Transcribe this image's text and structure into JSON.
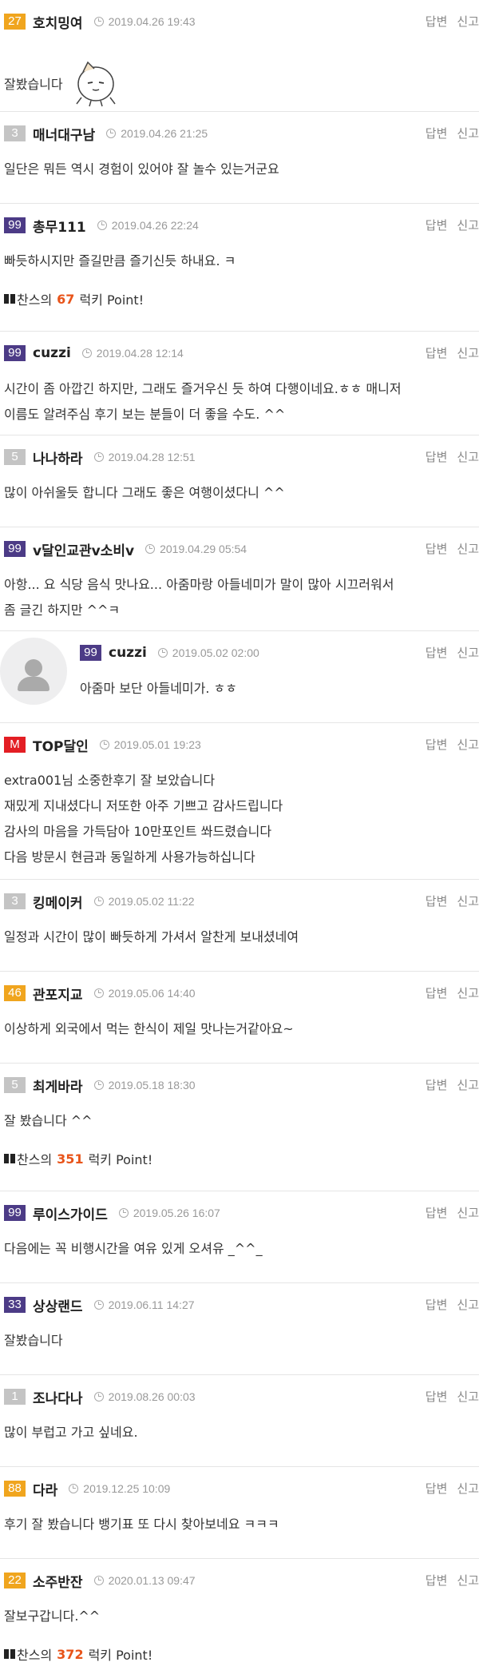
{
  "actions": {
    "reply": "답변",
    "report": "신고"
  },
  "point_prefix": "찬스의",
  "point_suffix": "럭키 Point!",
  "level_colors": {
    "purple": "#4c3b86",
    "gold": "#f0a51e",
    "grey": "#c4c4c4",
    "red": "#e31e24"
  },
  "comments": [
    {
      "level": "27",
      "nick": "호치밍여",
      "date": "2019.04.26 19:43",
      "text": [
        "잘봤습니다"
      ],
      "emoticon": "doodle-face-emoticon"
    },
    {
      "level": "3",
      "nick": "매너대구남",
      "date": "2019.04.26 21:25",
      "text": [
        "일단은 뭐든 역시 경험이 있어야 잘 놀수 있는거군요"
      ]
    },
    {
      "level": "99",
      "nick": "총무111",
      "date": "2019.04.26 22:24",
      "text": [
        "빠듯하시지만 즐길만큼 즐기신듯 하내요. ㅋ"
      ],
      "points": "67"
    },
    {
      "level": "99",
      "nick": "cuzzi",
      "date": "2019.04.28 12:14",
      "text": [
        "시간이 좀 아깝긴 하지만, 그래도 즐거우신 듯 하여 다행이네요.ㅎㅎ 매니저",
        "이름도 알려주심 후기 보는 분들이 더 좋을 수도. ^^"
      ]
    },
    {
      "level": "5",
      "nick": "나나하라",
      "date": "2019.04.28 12:51",
      "text": [
        "많이 아쉬울듯 합니다 그래도 좋은 여행이셨다니 ^^"
      ]
    },
    {
      "level": "99",
      "nick": "v달인교관v소비v",
      "date": "2019.04.29 05:54",
      "text": [
        "아항... 요 식당 음식 맛나요... 아줌마랑 아들네미가 말이 많아 시끄러워서",
        "좀 글긴 하지만 ^^ㅋ"
      ]
    },
    {
      "level": "99",
      "nick": "cuzzi",
      "date": "2019.05.02 02:00",
      "text": [
        "아줌마 보단 아들네미가. ㅎㅎ"
      ],
      "reply": true
    },
    {
      "level": "M",
      "nick": "TOP달인",
      "date": "2019.05.01 19:23",
      "text": [
        "extra001님 소중한후기 잘 보았습니다",
        "재밌게 지내셨다니 저또한 아주 기쁘고 감사드립니다",
        "감사의 마음을 가득담아 10만포인트 쏴드렸습니다",
        "다음 방문시 현금과 동일하게 사용가능하십니다"
      ]
    },
    {
      "level": "3",
      "nick": "킹메이커",
      "date": "2019.05.02 11:22",
      "text": [
        "일정과 시간이 많이 빠듯하게 가셔서 알찬게 보내셨네여"
      ]
    },
    {
      "level": "46",
      "nick": "관포지교",
      "date": "2019.05.06 14:40",
      "text": [
        "이상하게 외국에서 먹는 한식이 제일 맛나는거같아요~"
      ]
    },
    {
      "level": "5",
      "nick": "최게바라",
      "date": "2019.05.18 18:30",
      "text": [
        "잘 봤습니다 ^^"
      ],
      "points": "351"
    },
    {
      "level": "99",
      "nick": "루이스가이드",
      "date": "2019.05.26 16:07",
      "text": [
        "다음에는 꼭 비행시간을 여유 있게 오셔유 _^^_"
      ]
    },
    {
      "level": "33",
      "nick": "상상랜드",
      "date": "2019.06.11 14:27",
      "text": [
        "잘봤습니다"
      ]
    },
    {
      "level": "1",
      "nick": "조나다나",
      "date": "2019.08.26 00:03",
      "text": [
        "많이 부럽고 가고 싶네요."
      ]
    },
    {
      "level": "88",
      "nick": "다라",
      "date": "2019.12.25 10:09",
      "text": [
        "후기 잘 봤습니다 뱅기표 또 다시 찾아보네요 ㅋㅋㅋ"
      ]
    },
    {
      "level": "22",
      "nick": "소주반잔",
      "date": "2020.01.13 09:47",
      "text": [
        "잘보구갑니다.^^"
      ],
      "points": "372"
    }
  ]
}
